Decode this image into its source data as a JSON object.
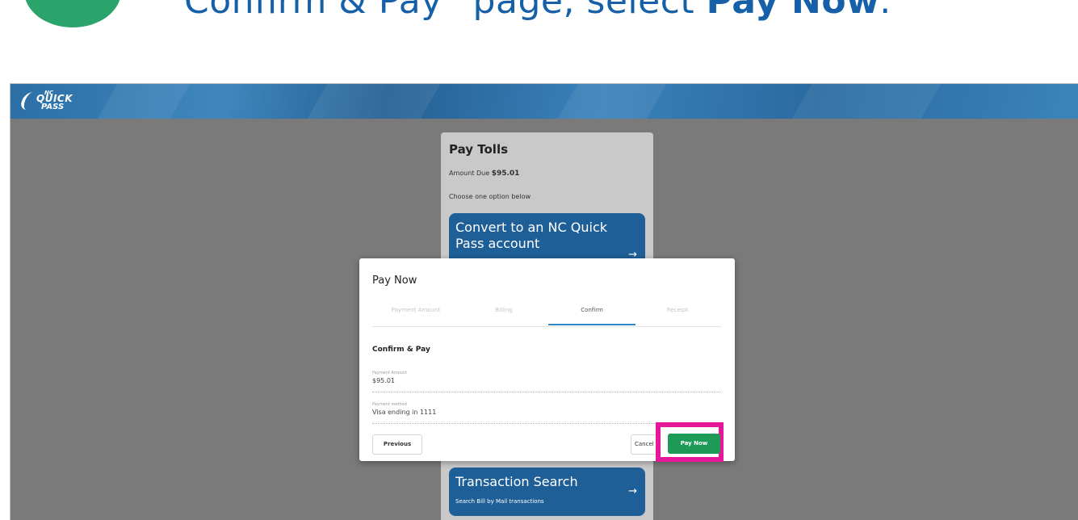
{
  "instruction": {
    "prefix": "Confirm & Pay” page, select ",
    "emphasis": "Pay Now",
    "suffix": "."
  },
  "header": {
    "logo_text": [
      "NC",
      "QUICK",
      "PASS"
    ]
  },
  "pay_tolls_card": {
    "title": "Pay Tolls",
    "amount_label": "Amount Due",
    "amount_value": "$95.01",
    "choose_text": "Choose one option below",
    "options": [
      {
        "title": "Convert to an NC Quick Pass account",
        "subtitle": ""
      },
      {
        "title": "Transaction Search",
        "subtitle": "Search Bill by Mail transactions"
      }
    ],
    "arrow": "→"
  },
  "dialog": {
    "title": "Pay Now",
    "steps": [
      "Payment Amount",
      "Billing",
      "Confirm",
      "Receipt"
    ],
    "active_step": 2,
    "section_title": "Confirm & Pay",
    "fields": [
      {
        "label": "Payment Amount",
        "value": "$95.01"
      },
      {
        "label": "Payment method",
        "value": "Visa ending in 1111"
      }
    ],
    "buttons": {
      "previous": "Previous",
      "cancel": "Cancel",
      "pay_now": "Pay Now"
    }
  },
  "colors": {
    "step_badge": "#2aa46a",
    "instruction_text": "#1560a8",
    "header_blue": "#2b6fa6",
    "tile_blue": "#1f5f97",
    "pay_now_green": "#1d9a55",
    "highlight_magenta": "#e6179a",
    "active_step_underline": "#2f87c4"
  }
}
